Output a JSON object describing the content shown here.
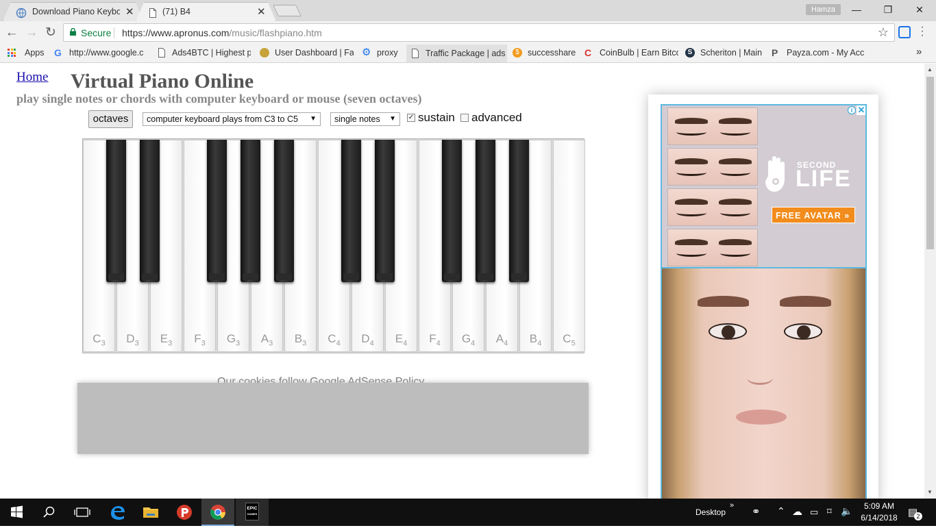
{
  "browser": {
    "tabs": [
      {
        "title": "Download Piano Keyboar",
        "active": false
      },
      {
        "title": "(71) B4",
        "active": true
      }
    ],
    "user": "Hamza",
    "secure_label": "Secure",
    "url_domain": "https://www.apronus.com",
    "url_path": "/music/flashpiano.htm",
    "bookmarks": [
      {
        "label": "Apps"
      },
      {
        "label": "http://www.google.c"
      },
      {
        "label": "Ads4BTC | Highest p"
      },
      {
        "label": "User Dashboard | Fa"
      },
      {
        "label": "proxy"
      },
      {
        "label": "Traffic Package | ads"
      },
      {
        "label": "successhare"
      },
      {
        "label": "CoinBulb | Earn Bitco"
      },
      {
        "label": "Scheriton | Main"
      },
      {
        "label": "Payza.com - My Acc"
      }
    ],
    "bookmarks_overflow": "»"
  },
  "page": {
    "home_link": "Home",
    "title": "Virtual Piano Online",
    "subtitle": "play single notes or chords with computer keyboard or mouse (seven octaves)",
    "controls": {
      "octaves_button": "octaves",
      "keyboard_select": "computer keyboard plays from C3 to C5",
      "mode_select": "single notes",
      "sustain_label": "sustain",
      "sustain_checked": true,
      "advanced_label": "advanced",
      "advanced_checked": false
    },
    "piano": {
      "white_keys": [
        {
          "note": "C",
          "octave": "3"
        },
        {
          "note": "D",
          "octave": "3"
        },
        {
          "note": "E",
          "octave": "3"
        },
        {
          "note": "F",
          "octave": "3"
        },
        {
          "note": "G",
          "octave": "3"
        },
        {
          "note": "A",
          "octave": "3"
        },
        {
          "note": "B",
          "octave": "3"
        },
        {
          "note": "C",
          "octave": "4"
        },
        {
          "note": "D",
          "octave": "4"
        },
        {
          "note": "E",
          "octave": "4"
        },
        {
          "note": "F",
          "octave": "4"
        },
        {
          "note": "G",
          "octave": "4"
        },
        {
          "note": "A",
          "octave": "4"
        },
        {
          "note": "B",
          "octave": "4"
        },
        {
          "note": "C",
          "octave": "5"
        }
      ]
    },
    "cookies_text": "Our cookies follow Google AdSense Policy."
  },
  "ad": {
    "brand_small": "SECOND",
    "brand_large": "LIFE",
    "cta": "FREE AVATAR »",
    "info_icon": "i",
    "close_icon": "✕"
  },
  "taskbar": {
    "desktop_label": "Desktop",
    "time": "5:09 AM",
    "date": "6/14/2018",
    "notification_count": "2",
    "epic_label_1": "EPIC",
    "epic_label_2": "GAMES"
  },
  "colors": {
    "link": "#1a0dab",
    "secure_green": "#0b8043",
    "ad_accent": "#f28c1c",
    "ad_border": "#5bb8e0"
  }
}
